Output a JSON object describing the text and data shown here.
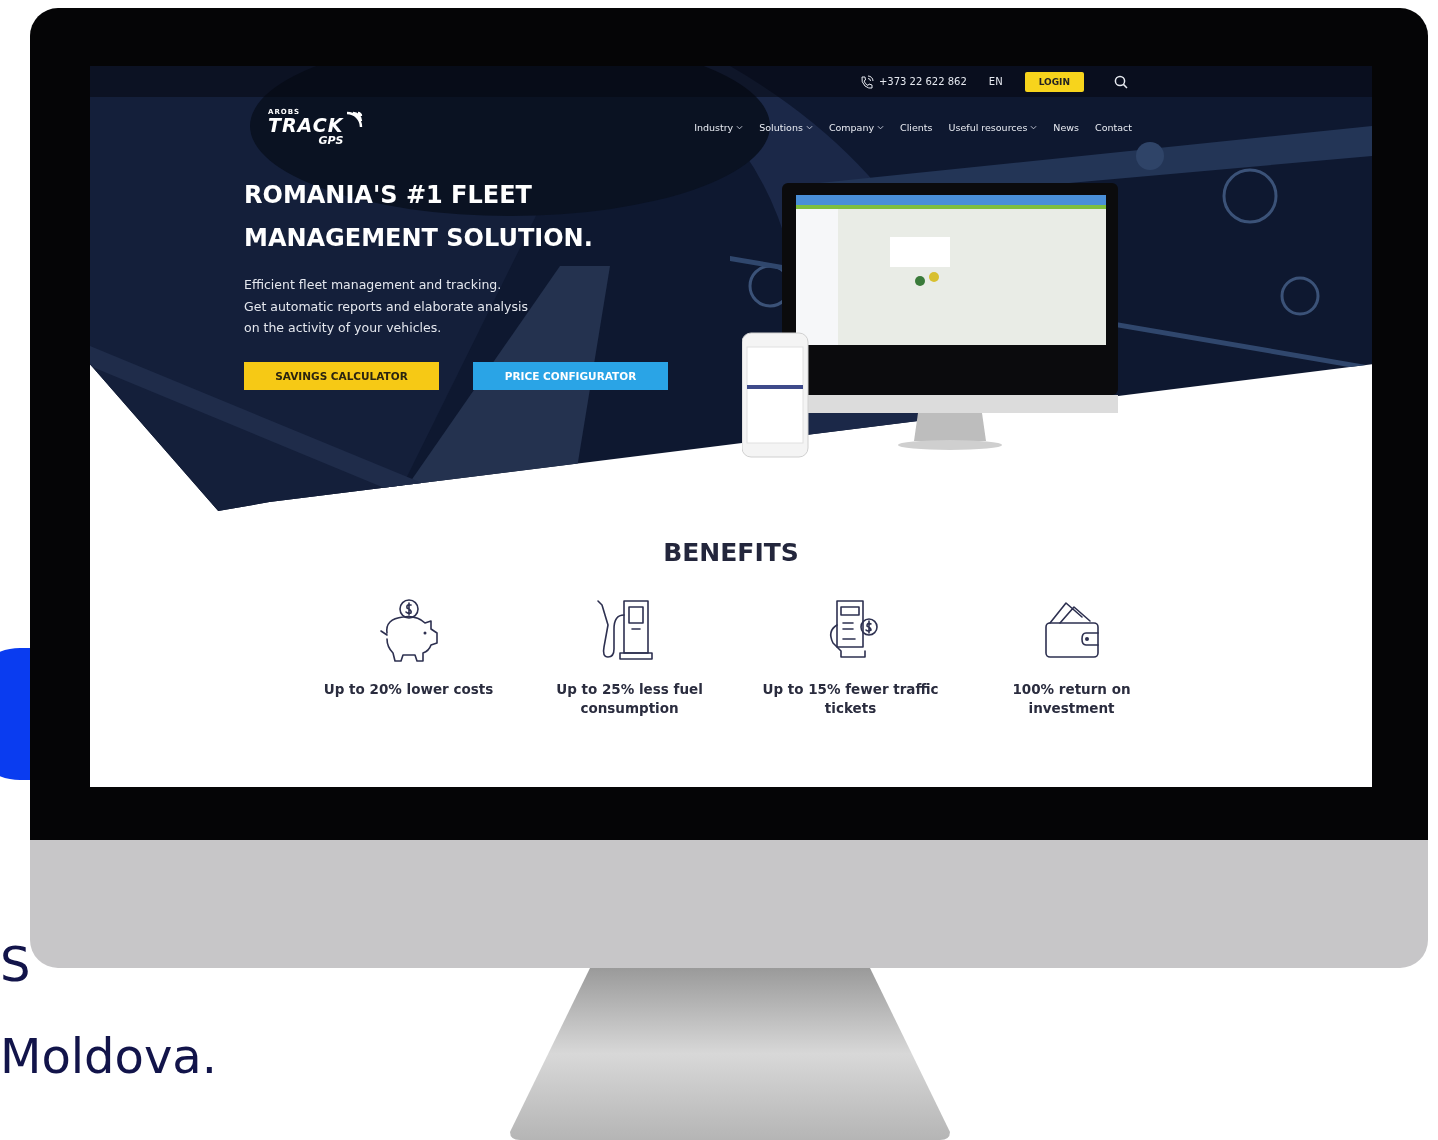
{
  "background_text": [
    "S",
    "Moldova."
  ],
  "topbar": {
    "phone": "+373 22 622 862",
    "language": "EN",
    "login": "LOGIN"
  },
  "logo": {
    "small": "AROBS",
    "main": "TRACK",
    "sub": "GPS"
  },
  "nav": [
    {
      "label": "Industry",
      "dropdown": true
    },
    {
      "label": "Solutions",
      "dropdown": true
    },
    {
      "label": "Company",
      "dropdown": true
    },
    {
      "label": "Clients",
      "dropdown": false
    },
    {
      "label": "Useful resources",
      "dropdown": true
    },
    {
      "label": "News",
      "dropdown": false
    },
    {
      "label": "Contact",
      "dropdown": false
    }
  ],
  "hero": {
    "title_lines": [
      "ROMANIA'S #1 FLEET",
      "MANAGEMENT SOLUTION."
    ],
    "text_lines": [
      "Efficient fleet management and tracking.",
      "Get automatic reports and elaborate analysis",
      "on the activity of your vehicles."
    ],
    "buttons": [
      {
        "label": "SAVINGS CALCULATOR",
        "kind": "primary"
      },
      {
        "label": "PRICE CONFIGURATOR",
        "kind": "secondary"
      }
    ],
    "media": {
      "kind": "picture"
    }
  },
  "benefits": {
    "title": "BENEFITS",
    "items": [
      {
        "kind": "piggy",
        "lines": [
          "Up to 20% lower costs"
        ]
      },
      {
        "kind": "fuel",
        "lines": [
          "Up to 25% less fuel",
          "consumption"
        ]
      },
      {
        "kind": "receipt",
        "lines": [
          "Up to 15% fewer traffic",
          "tickets"
        ]
      },
      {
        "kind": "wallet",
        "lines": [
          "100% return on",
          "investment"
        ]
      }
    ]
  }
}
